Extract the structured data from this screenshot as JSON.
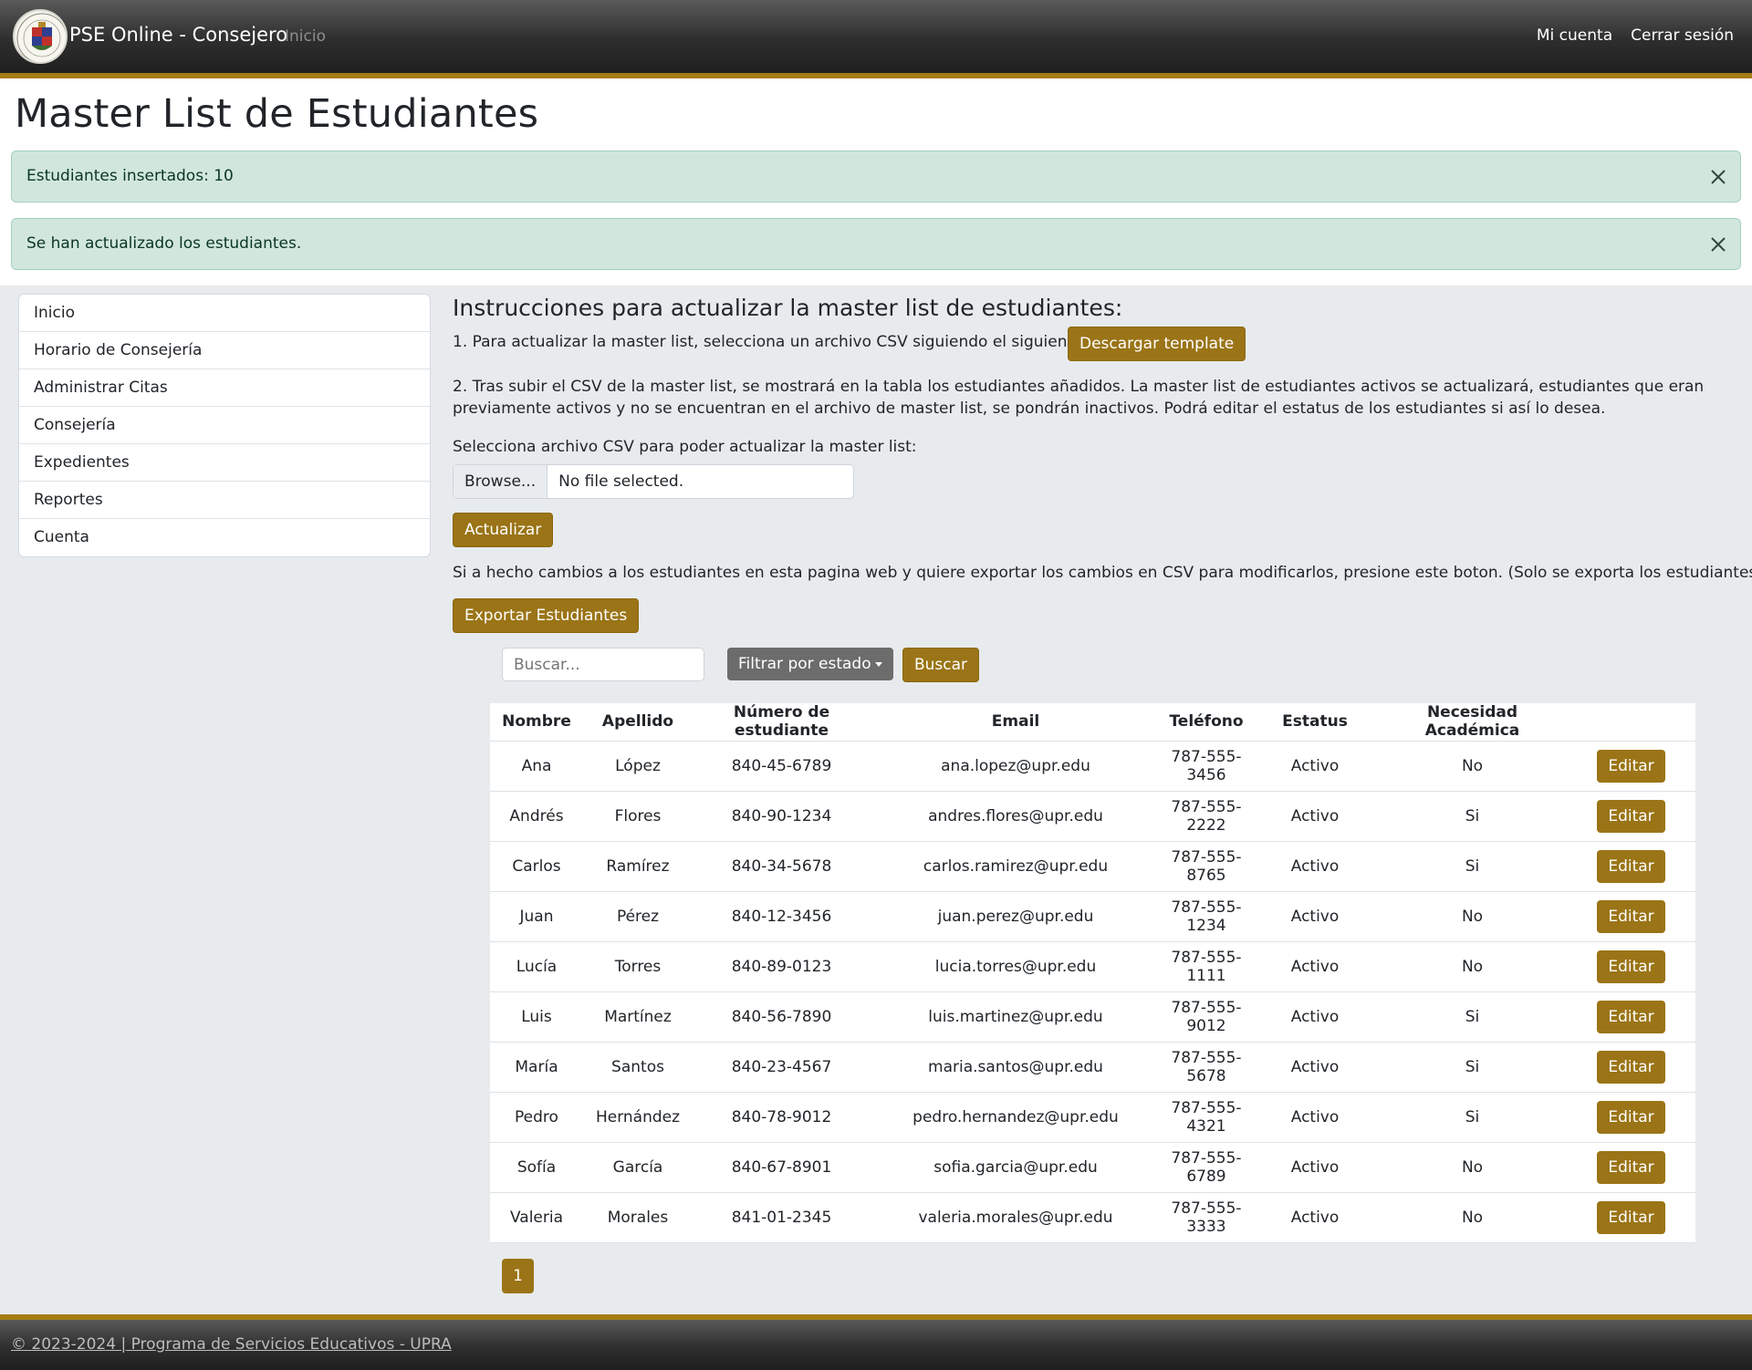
{
  "navbar": {
    "brand": "PSE Online - Consejero",
    "home_link": "Inicio",
    "my_account": "Mi cuenta",
    "logout": "Cerrar sesión"
  },
  "page": {
    "title": "Master List de Estudiantes"
  },
  "alerts": [
    {
      "text": "Estudiantes insertados: 10"
    },
    {
      "text": "Se han actualizado los estudiantes."
    }
  ],
  "sidebar": {
    "items": [
      {
        "label": "Inicio"
      },
      {
        "label": "Horario de Consejería"
      },
      {
        "label": "Administrar Citas"
      },
      {
        "label": "Consejería"
      },
      {
        "label": "Expedientes"
      },
      {
        "label": "Reportes"
      },
      {
        "label": "Cuenta"
      }
    ]
  },
  "instructions": {
    "heading": "Instrucciones para actualizar la master list de estudiantes:",
    "step1": "1. Para actualizar la master list, selecciona un archivo CSV siguiendo el siguiente formato:",
    "download_template": "Descargar template",
    "step2": "2. Tras subir el CSV de la master list, se mostrará en la tabla los estudiantes añadidos. La master list de estudiantes activos se actualizará, estudiantes que eran previamente activos y no se encuentran en el archivo de master list, se pondrán inactivos. Podrá editar el estatus de los estudiantes si así lo desea.",
    "select_label": "Selecciona archivo CSV para poder actualizar la master list:",
    "browse": "Browse...",
    "no_file": "No file selected.",
    "update_button": "Actualizar",
    "export_text": "Si a hecho cambios a los estudiantes en esta pagina web y quiere exportar los cambios en CSV para modificarlos, presione este boton. (Solo se exporta los estudiantes activos.)",
    "export_button": "Exportar Estudiantes"
  },
  "filters": {
    "search_placeholder": "Buscar...",
    "filter_button": "Filtrar por estado",
    "search_button": "Buscar"
  },
  "table": {
    "headers": [
      "Nombre",
      "Apellido",
      "Número de estudiante",
      "Email",
      "Teléfono",
      "Estatus",
      "Necesidad Académica",
      ""
    ],
    "edit_label": "Editar",
    "rows": [
      [
        "Ana",
        "López",
        "840-45-6789",
        "ana.lopez@upr.edu",
        "787-555-3456",
        "Activo",
        "No"
      ],
      [
        "Andrés",
        "Flores",
        "840-90-1234",
        "andres.flores@upr.edu",
        "787-555-2222",
        "Activo",
        "Si"
      ],
      [
        "Carlos",
        "Ramírez",
        "840-34-5678",
        "carlos.ramirez@upr.edu",
        "787-555-8765",
        "Activo",
        "Si"
      ],
      [
        "Juan",
        "Pérez",
        "840-12-3456",
        "juan.perez@upr.edu",
        "787-555-1234",
        "Activo",
        "No"
      ],
      [
        "Lucía",
        "Torres",
        "840-89-0123",
        "lucia.torres@upr.edu",
        "787-555-1111",
        "Activo",
        "No"
      ],
      [
        "Luis",
        "Martínez",
        "840-56-7890",
        "luis.martinez@upr.edu",
        "787-555-9012",
        "Activo",
        "Si"
      ],
      [
        "María",
        "Santos",
        "840-23-4567",
        "maria.santos@upr.edu",
        "787-555-5678",
        "Activo",
        "Si"
      ],
      [
        "Pedro",
        "Hernández",
        "840-78-9012",
        "pedro.hernandez@upr.edu",
        "787-555-4321",
        "Activo",
        "Si"
      ],
      [
        "Sofía",
        "García",
        "840-67-8901",
        "sofia.garcia@upr.edu",
        "787-555-6789",
        "Activo",
        "No"
      ],
      [
        "Valeria",
        "Morales",
        "841-01-2345",
        "valeria.morales@upr.edu",
        "787-555-3333",
        "Activo",
        "No"
      ]
    ]
  },
  "pagination": {
    "current_page": "1"
  },
  "footer": {
    "text": "© 2023-2024 | Programa de Servicios Educativos - UPRA"
  },
  "colors": {
    "accent_gold": "#9a7416",
    "alert_green": "#d1e7dd",
    "content_bg": "#e8ebee"
  }
}
